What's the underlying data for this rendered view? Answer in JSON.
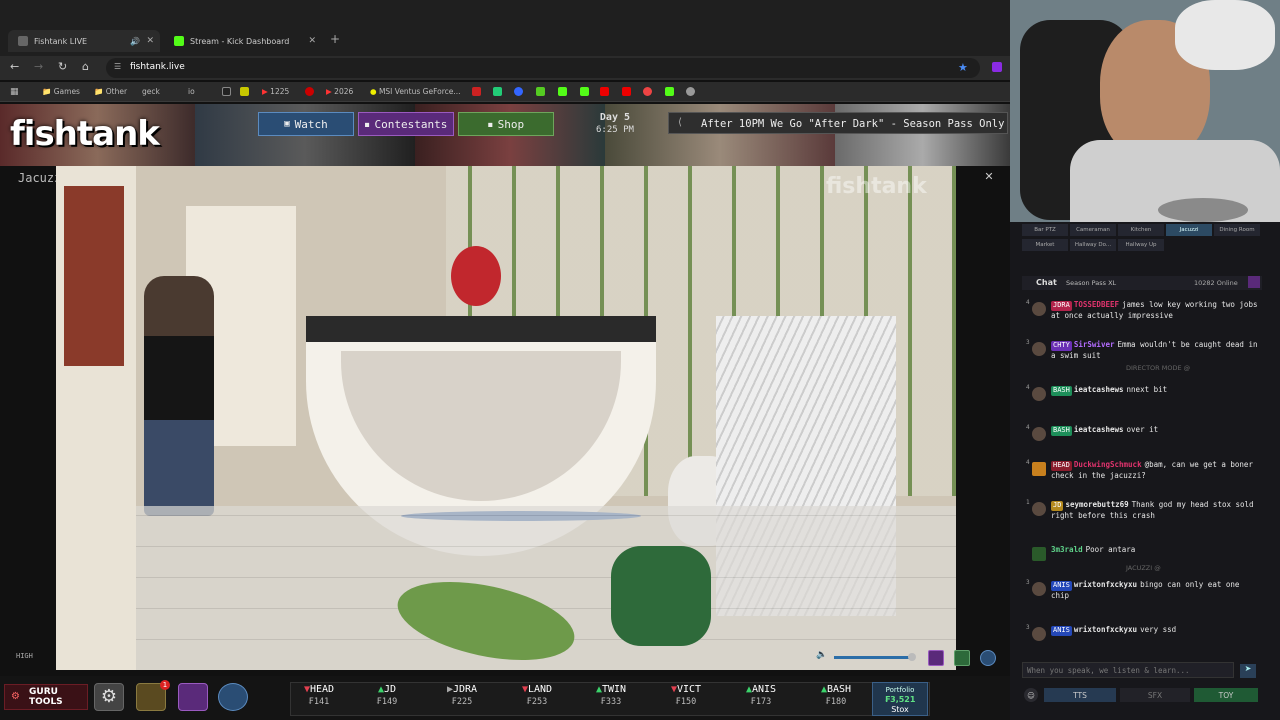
{
  "browser": {
    "tabs": [
      {
        "title": "Fishtank LIVE",
        "active": true
      },
      {
        "title": "Stream - Kick Dashboard",
        "active": false
      }
    ],
    "url": "fishtank.live",
    "bookmarks": [
      "Games",
      "Other",
      "geck",
      "io",
      "1225",
      "2026",
      "MSI Ventus GeForce..."
    ]
  },
  "site": {
    "logo": "fishtank",
    "nav": {
      "watch": "Watch",
      "contestants": "Contestants",
      "shop": "Shop"
    },
    "day": "Day 5",
    "time": "6:25 PM",
    "ticker": "After 10PM We Go \"After Dark\" - Season Pass Only"
  },
  "video": {
    "camera": "Jacuzzi",
    "watermark": "fishtank",
    "quality": "HIGH",
    "volume": 0.95
  },
  "bottom": {
    "guru": "GURU TOOLS",
    "notification_count": "1",
    "stocks": [
      {
        "name": "HEAD",
        "value": "₣141",
        "dir": "down"
      },
      {
        "name": "JD",
        "value": "₣149",
        "dir": "up"
      },
      {
        "name": "JDRA",
        "value": "₣225",
        "dir": "flat"
      },
      {
        "name": "LAND",
        "value": "₣253",
        "dir": "down"
      },
      {
        "name": "TWIN",
        "value": "₣333",
        "dir": "up"
      },
      {
        "name": "VICT",
        "value": "₣150",
        "dir": "down"
      },
      {
        "name": "ANIS",
        "value": "₣173",
        "dir": "up"
      },
      {
        "name": "BASH",
        "value": "₣180",
        "dir": "up"
      }
    ],
    "portfolio_label": "Portfolio",
    "portfolio_value": "₣3,521",
    "stox_label": "Stox"
  },
  "camera_tabs": [
    {
      "label": "Bar PTZ",
      "selected": false
    },
    {
      "label": "Cameraman",
      "selected": false
    },
    {
      "label": "Kitchen",
      "selected": false
    },
    {
      "label": "Jacuzzi",
      "selected": true
    },
    {
      "label": "Dining Room",
      "selected": false
    },
    {
      "label": "Market",
      "selected": false
    },
    {
      "label": "Hallway Do...",
      "selected": false
    },
    {
      "label": "Hallway Up",
      "selected": false
    }
  ],
  "chat": {
    "title": "Chat",
    "tab2": "Season Pass XL",
    "online": "10282 Online",
    "messages": [
      {
        "num": "4",
        "badge": "JDRA",
        "badge_color": "#b2234b",
        "user": "TOSSEDBEEF",
        "user_color": "#e0336d",
        "text": "james low key working two jobs at once actually impressive"
      },
      {
        "num": "3",
        "badge": "CHTY",
        "badge_color": "#6a2fb5",
        "user": "SirSwiver",
        "user_color": "#b36cff",
        "text": "Emma wouldn't be caught dead in a swim suit"
      },
      {
        "num": "4",
        "badge": "BASH",
        "badge_color": "#1d8f5a",
        "user": "ieatcashews",
        "user_color": "#e6e6e6",
        "text": "nnext bit"
      },
      {
        "num": "4",
        "badge": "BASH",
        "badge_color": "#1d8f5a",
        "user": "ieatcashews",
        "user_color": "#e6e6e6",
        "text": "over it"
      },
      {
        "num": "4",
        "badge": "HEAD",
        "badge_color": "#8a1c2c",
        "user": "DuckwingSchmuck",
        "user_color": "#e0336d",
        "text": "@bam, can we get a boner check in the jacuzzi?"
      },
      {
        "num": "1",
        "badge": "JD",
        "badge_color": "#b58a1e",
        "user": "seymorebuttz69",
        "user_color": "#e6e6e6",
        "text": "Thank god my head stox sold right before this crash"
      },
      {
        "num": "",
        "badge": "",
        "badge_color": "#333",
        "user": "3m3rald",
        "user_color": "#5fd38a",
        "text": "Poor antara"
      },
      {
        "num": "3",
        "badge": "ANIS",
        "badge_color": "#2448b8",
        "user": "wrixtonfxckyxu",
        "user_color": "#e6e6e6",
        "text": "bingo can only eat one chip"
      },
      {
        "num": "3",
        "badge": "ANIS",
        "badge_color": "#2448b8",
        "user": "wrixtonfxckyxu",
        "user_color": "#e6e6e6",
        "text": "very ssd"
      }
    ],
    "director_mode": "DIRECTOR MODE @",
    "jacuzzi_mode": "JACUZZI @",
    "input_placeholder": "When you speak, we listen & learn...",
    "buttons": {
      "tts": "TTS",
      "sfx": "SFX",
      "toy": "TOY"
    }
  }
}
